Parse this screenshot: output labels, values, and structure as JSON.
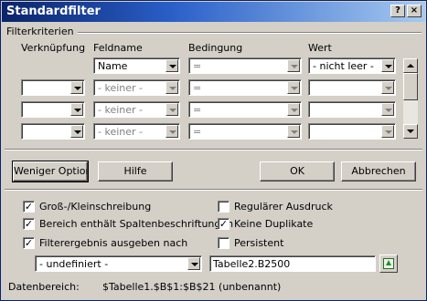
{
  "window": {
    "title": "Standardfilter",
    "help_glyph": "?",
    "close_glyph": "×"
  },
  "criteria": {
    "section_label": "Filterkriterien",
    "headers": {
      "link": "Verknüpfung",
      "field": "Feldname",
      "condition": "Bedingung",
      "value": "Wert"
    },
    "rows": [
      {
        "link": "",
        "field": "Name",
        "condition": "=",
        "value": "- nicht leer -",
        "enabled": true
      },
      {
        "link": "",
        "field": "- keiner -",
        "condition": "=",
        "value": "",
        "enabled": false
      },
      {
        "link": "",
        "field": "- keiner -",
        "condition": "=",
        "value": "",
        "enabled": false
      },
      {
        "link": "",
        "field": "- keiner -",
        "condition": "=",
        "value": "",
        "enabled": false
      }
    ]
  },
  "buttons": {
    "less_options": "Weniger Optione",
    "help": "Hilfe",
    "ok": "OK",
    "cancel": "Abbrechen"
  },
  "options": {
    "case_sensitive": {
      "label": "Groß-/Kleinschreibung",
      "checked": true
    },
    "has_headers": {
      "label": "Bereich enthält Spaltenbeschriftungen",
      "checked": true
    },
    "copy_results": {
      "label": "Filterergebnis ausgeben nach",
      "checked": true
    },
    "regex": {
      "label": "Regulärer Ausdruck",
      "checked": false
    },
    "no_duplicates": {
      "label": "Keine Duplikate",
      "checked": true
    },
    "persistent": {
      "label": "Persistent",
      "checked": false
    }
  },
  "output": {
    "target_select": "- undefiniert -",
    "target_ref": "Tabelle2.B2500"
  },
  "data_range": {
    "label": "Datenbereich:",
    "value": "$Tabelle1.$B$1:$B$21 (unbenannt)"
  }
}
